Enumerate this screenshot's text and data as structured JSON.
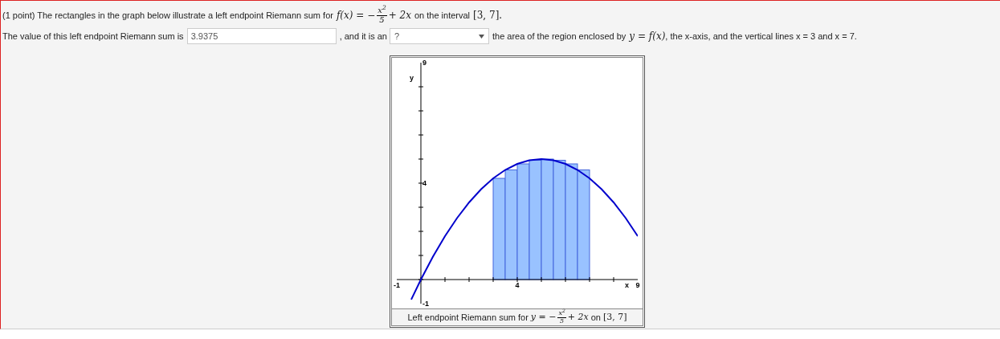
{
  "prompt": {
    "text_before": "(1 point) The rectangles in the graph below illustrate a left endpoint Riemann sum for",
    "formula_lhs": "f(x) = −",
    "numerator": "x$^{2}$",
    "denominator": "5",
    "formula_rhs": "+ 2x",
    "text_after": "on the interval",
    "interval": "[3, 7]."
  },
  "answer": {
    "label": "The value of this left endpoint Riemann sum is",
    "value": "3.9375",
    "middle": ", and it is an",
    "select_value": "?",
    "text_after_select": "the area of the region enclosed by",
    "math": "y = f(x)",
    "ending": ", the x-axis, and the vertical lines x = 3 and x = 7."
  },
  "graph": {
    "chart_data": {
      "type": "bar",
      "xlabel": "x",
      "ylabel": "y",
      "xlim": [
        -1,
        9
      ],
      "ylim": [
        -1,
        9
      ],
      "xticks": [
        -1,
        4,
        9
      ],
      "yticks": [
        -1,
        4,
        9
      ],
      "x": [
        3.25,
        3.75,
        4.25,
        4.75,
        5.25,
        5.75,
        6.25,
        6.75
      ],
      "series": [
        {
          "color": "#99c2ff",
          "values": [
            4.2,
            4.55,
            4.8,
            4.95,
            5,
            4.95,
            4.8,
            4.55
          ]
        },
        {
          "type": "line",
          "color": "#0000cc",
          "x": [
            -0.4,
            0,
            0.5,
            1,
            1.5,
            2,
            2.5,
            3,
            3.5,
            4,
            4.5,
            5,
            5.5,
            6,
            6.5,
            7,
            7.5,
            8,
            8.5,
            9
          ],
          "values": [
            -0.83,
            0,
            0.95,
            1.8,
            2.55,
            3.2,
            3.75,
            4.2,
            4.55,
            4.8,
            4.95,
            5,
            4.95,
            4.8,
            4.55,
            4.2,
            3.75,
            3.2,
            2.55,
            1.8
          ]
        }
      ]
    },
    "caption": {
      "text": "Left endpoint Riemann sum for",
      "formula_lhs": "y = −",
      "numerator": "x$^{2}$",
      "denominator": "5",
      "formula_rhs": "+ 2x",
      "on": "on",
      "interval": "[3, 7]"
    }
  }
}
